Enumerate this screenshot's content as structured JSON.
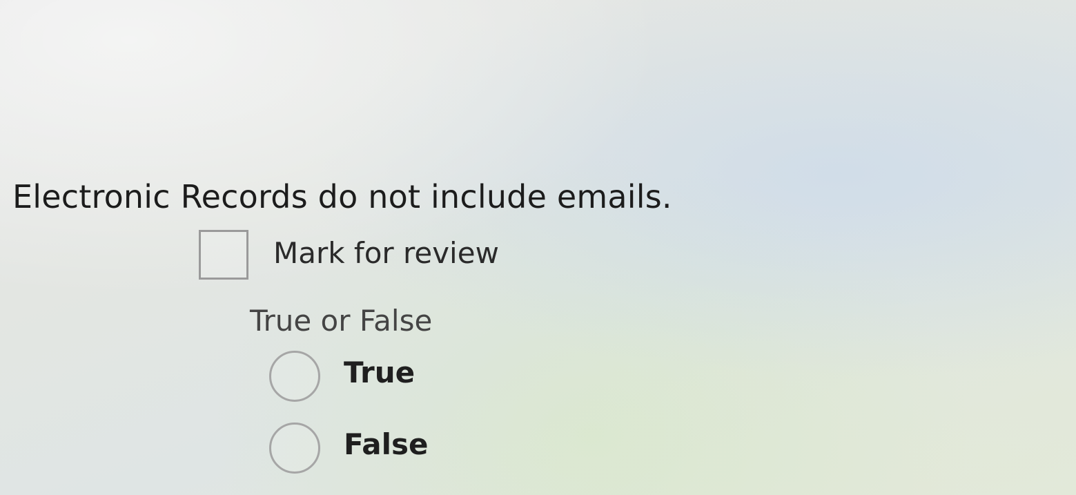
{
  "question": {
    "text": "Electronic Records do not include emails."
  },
  "review": {
    "label": "Mark for review",
    "checked": false
  },
  "question_type": "True or False",
  "options": [
    {
      "label": "True",
      "selected": false
    },
    {
      "label": "False",
      "selected": false
    }
  ],
  "colors": {
    "text": "#1c1c1c",
    "control_border": "#9a9a9a",
    "background": "#e4e7e2"
  }
}
